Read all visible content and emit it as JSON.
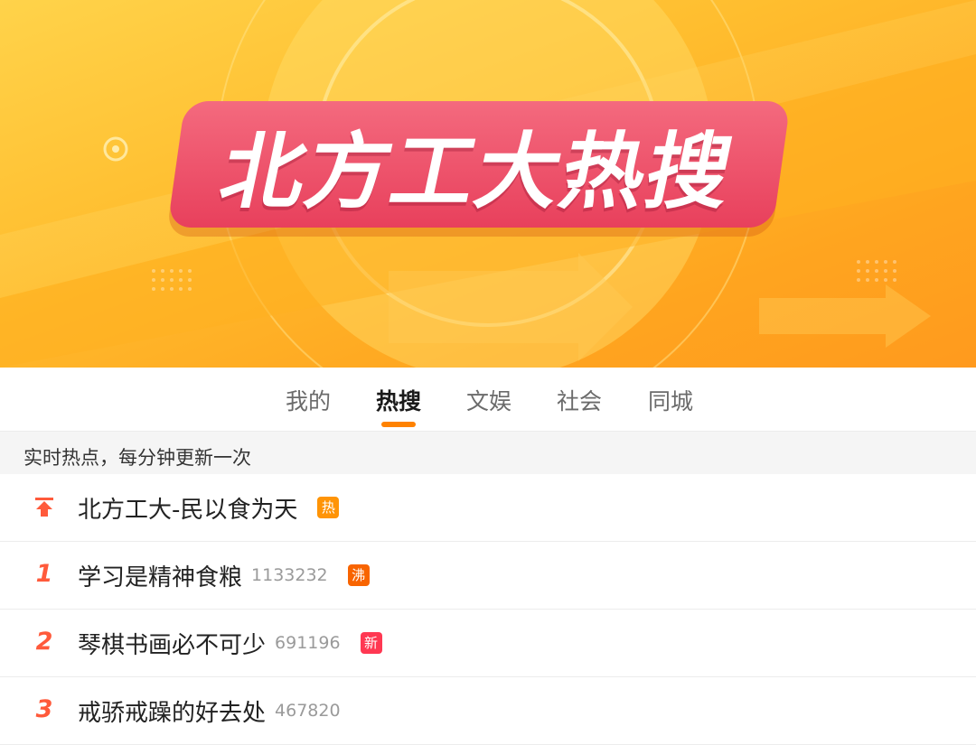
{
  "banner": {
    "title": "北方工大热搜"
  },
  "tabs": [
    {
      "label": "我的",
      "active": false
    },
    {
      "label": "热搜",
      "active": true
    },
    {
      "label": "文娱",
      "active": false
    },
    {
      "label": "社会",
      "active": false
    },
    {
      "label": "同城",
      "active": false
    }
  ],
  "subtitle": "实时热点，每分钟更新一次",
  "list": [
    {
      "rank": "",
      "rank_icon": "pin-top-icon",
      "title": "北方工大-民以食为天",
      "count": "",
      "badge": "热",
      "badge_color": "#ff9406"
    },
    {
      "rank": "1",
      "title": "学习是精神食粮",
      "count": "1133232",
      "badge": "沸",
      "badge_color": "#f86400"
    },
    {
      "rank": "2",
      "title": "琴棋书画必不可少",
      "count": "691196",
      "badge": "新",
      "badge_color": "#ff3852"
    },
    {
      "rank": "3",
      "title": "戒骄戒躁的好去处",
      "count": "467820",
      "badge": "",
      "badge_color": ""
    }
  ],
  "colors": {
    "accent": "#ff8200",
    "rank": "#ff5a3b",
    "banner_title_bg": "#e8405c",
    "banner_bg": "#ffbd2e"
  }
}
